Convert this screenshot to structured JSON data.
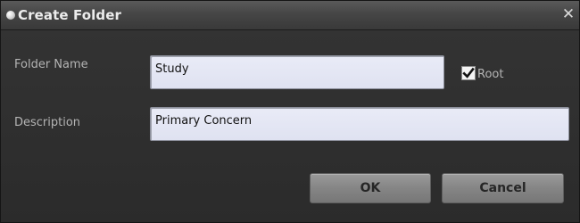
{
  "dialog": {
    "title": "Create Folder",
    "close_glyph": "✕",
    "title_icon": "dot-icon",
    "close_icon": "close-icon"
  },
  "form": {
    "folder_name_label": "Folder Name",
    "folder_name_value": "Study",
    "root_label": "Root",
    "root_checked": true,
    "description_label": "Description",
    "description_value": "Primary Concern"
  },
  "buttons": {
    "ok_label": "OK",
    "cancel_label": "Cancel"
  }
}
